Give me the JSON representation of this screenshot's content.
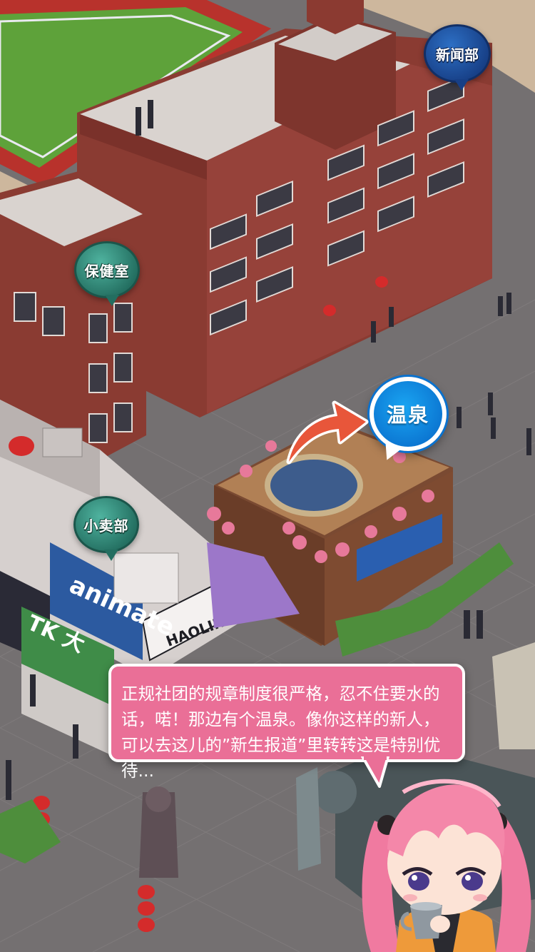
{
  "map": {
    "locations": [
      {
        "id": "news-club",
        "label": "新闻部",
        "style": "blue"
      },
      {
        "id": "infirmary",
        "label": "保健室",
        "style": "teal"
      },
      {
        "id": "shop",
        "label": "小卖部",
        "style": "teal"
      },
      {
        "id": "hot-spring",
        "label": "温泉",
        "style": "active"
      }
    ],
    "signs": {
      "animate": "animate",
      "haoliners": "HAOLINERS 绘梦",
      "tk": "TK 大"
    }
  },
  "dialog": {
    "text": "正规社团的规章制度很严格，忍不住要水的话，喏！那边有个温泉。像你这样的新人，可以去这儿的”新生报道”里转转这是特别优待..."
  },
  "colors": {
    "dialog_bg": "#ea6f97",
    "active_bubble": "#0a72cf",
    "arrow": "#e8563a",
    "npc_hair": "#f07aa0"
  }
}
